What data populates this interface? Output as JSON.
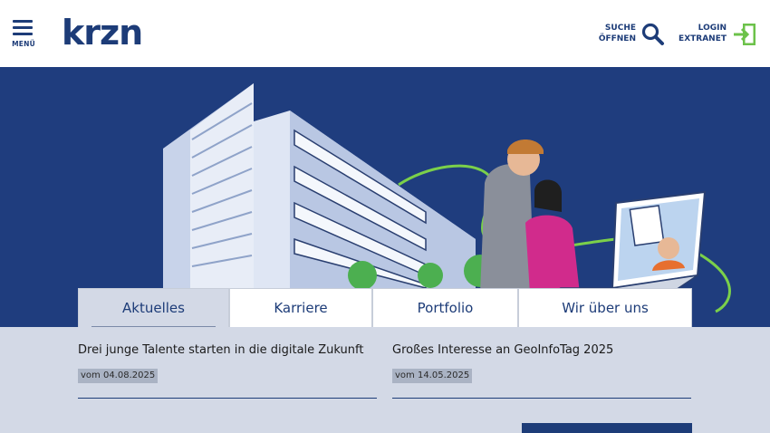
{
  "header": {
    "menu_label": "MENÜ",
    "logo_text": "krzn",
    "search_label_1": "SUCHE",
    "search_label_2": "ÖFFNEN",
    "login_label_1": "LOGIN",
    "login_label_2": "EXTRANET"
  },
  "tabs": [
    {
      "label": "Aktuelles",
      "active": true
    },
    {
      "label": "Karriere",
      "active": false
    },
    {
      "label": "Portfolio",
      "active": false
    },
    {
      "label": "Wir über uns",
      "active": false
    }
  ],
  "news": [
    {
      "title": "Drei junge Talente starten in die digitale Zukunft",
      "date": "vom 04.08.2025"
    },
    {
      "title": "Großes Interesse an GeoInfoTag 2025",
      "date": "vom 14.05.2025"
    }
  ],
  "colors": {
    "brand_blue": "#1d3c78",
    "hero_blue": "#1f3d7e",
    "login_green": "#6cc24a",
    "content_bg": "#d3d9e6"
  },
  "icons": {
    "menu": "hamburger-icon",
    "search": "magnifier-icon",
    "login": "arrow-into-door-icon"
  }
}
